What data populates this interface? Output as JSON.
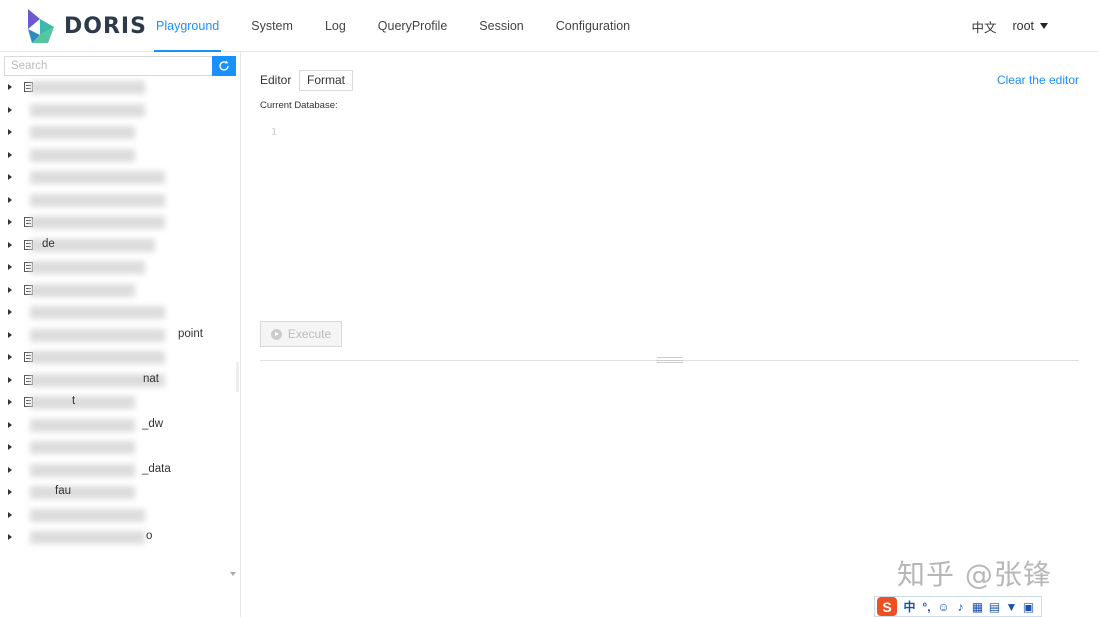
{
  "brand": {
    "name": "DORIS"
  },
  "nav": {
    "items": [
      {
        "label": "Playground",
        "active": true
      },
      {
        "label": "System",
        "active": false
      },
      {
        "label": "Log",
        "active": false
      },
      {
        "label": "QueryProfile",
        "active": false
      },
      {
        "label": "Session",
        "active": false
      },
      {
        "label": "Configuration",
        "active": false
      }
    ],
    "language": "中文",
    "user": "root"
  },
  "sidebar": {
    "search_placeholder": "Search",
    "refresh_icon": "refresh-icon",
    "tree_items": [
      {
        "label": "",
        "has_db_icon": true
      },
      {
        "label": "",
        "has_db_icon": false
      },
      {
        "label": "",
        "has_db_icon": false
      },
      {
        "label": "",
        "has_db_icon": false
      },
      {
        "label": "",
        "has_db_icon": false
      },
      {
        "label": "",
        "has_db_icon": false
      },
      {
        "label": "",
        "has_db_icon": true
      },
      {
        "label": "de",
        "has_db_icon": true
      },
      {
        "label": "",
        "has_db_icon": true
      },
      {
        "label": "",
        "has_db_icon": true
      },
      {
        "label": "",
        "has_db_icon": false
      },
      {
        "label": "point",
        "has_db_icon": false
      },
      {
        "label": "",
        "has_db_icon": true
      },
      {
        "label": "nat",
        "has_db_icon": true
      },
      {
        "label": "t",
        "has_db_icon": true
      },
      {
        "label": "_dw",
        "has_db_icon": false
      },
      {
        "label": "",
        "has_db_icon": false
      },
      {
        "label": "_data",
        "has_db_icon": false
      },
      {
        "label": "fau",
        "has_db_icon": false
      },
      {
        "label": "",
        "has_db_icon": false
      },
      {
        "label": "o",
        "has_db_icon": false
      }
    ]
  },
  "editor": {
    "label": "Editor",
    "format_label": "Format",
    "clear_label": "Clear the editor",
    "current_db_label": "Current Database:",
    "line_number": "1",
    "execute_label": "Execute"
  },
  "watermark": {
    "text": "知乎 @张锋"
  },
  "ime": {
    "logo": "S",
    "lang": "中"
  }
}
